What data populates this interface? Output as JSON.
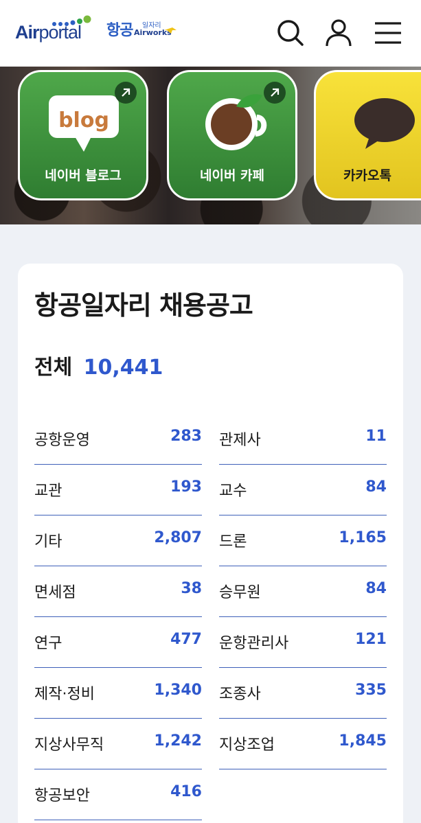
{
  "header": {
    "logo_main": "Air",
    "logo_sub": "portal",
    "logo2_ko": "항공",
    "logo2_sub": "일자리",
    "logo2_en": "Airworks",
    "icons": [
      "search-icon",
      "user-icon",
      "menu-icon"
    ]
  },
  "banner": {
    "tiles": [
      {
        "label": "네이버 블로그",
        "badge": "blog",
        "icon": "blog-icon"
      },
      {
        "label": "네이버 카페",
        "icon": "cafe-cup-icon"
      },
      {
        "label": "카카오톡",
        "icon": "kakao-bubble-icon"
      }
    ]
  },
  "card": {
    "title": "항공일자리 채용공고",
    "total_label": "전체",
    "total_value": "10,441",
    "categories": [
      {
        "name": "공항운영",
        "count": "283"
      },
      {
        "name": "관제사",
        "count": "11"
      },
      {
        "name": "교관",
        "count": "193"
      },
      {
        "name": "교수",
        "count": "84"
      },
      {
        "name": "기타",
        "count": "2,807"
      },
      {
        "name": "드론",
        "count": "1,165"
      },
      {
        "name": "면세점",
        "count": "38"
      },
      {
        "name": "승무원",
        "count": "84"
      },
      {
        "name": "연구",
        "count": "477"
      },
      {
        "name": "운항관리사",
        "count": "121"
      },
      {
        "name": "제작·정비",
        "count": "1,340"
      },
      {
        "name": "조종사",
        "count": "335"
      },
      {
        "name": "지상사무직",
        "count": "1,242"
      },
      {
        "name": "지상조업",
        "count": "1,845"
      },
      {
        "name": "항공보안",
        "count": "416"
      }
    ]
  },
  "colors": {
    "accent": "#2f58cd",
    "naver_green": "#3d9a3f",
    "kakao_yellow": "#f4da2e"
  }
}
